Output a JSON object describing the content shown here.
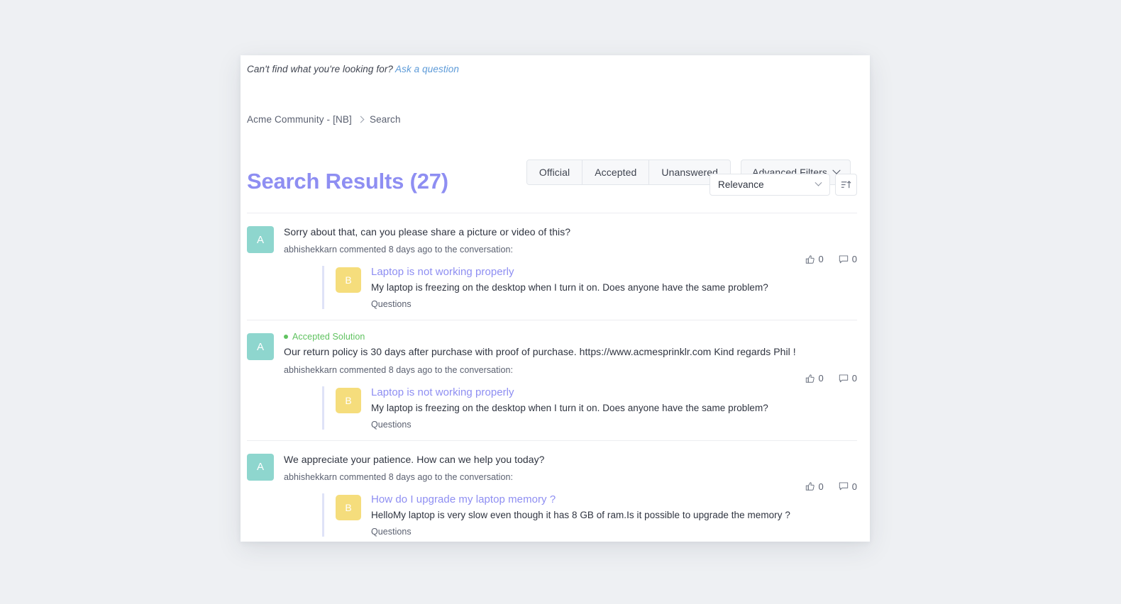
{
  "top_bar": {
    "prompt": "Can't find what you're looking for?",
    "ask_link": "Ask a question"
  },
  "breadcrumb": {
    "root": "Acme Community - [NB]",
    "current": "Search"
  },
  "filters": {
    "official": "Official",
    "accepted": "Accepted",
    "unanswered": "Unanswered",
    "advanced": "Advanced Filters"
  },
  "results_header": {
    "title": "Search Results (27)",
    "sort_value": "Relevance"
  },
  "colors": {
    "accent_purple": "#8e8ef2",
    "link_blue": "#5c9ad8",
    "accepted_green": "#5fc25f",
    "avatar_teal": "#8ed6ce",
    "avatar_yellow": "#f5dd7c"
  },
  "results": [
    {
      "avatar": "A",
      "accepted_label": "",
      "snippet": "Sorry about that, can you please share a picture or video of this?",
      "meta": "abhishekkarn commented 8 days ago to the conversation:",
      "likes": "0",
      "comments": "0",
      "quoted": {
        "avatar": "B",
        "title": "Laptop is not working properly",
        "description": "My laptop is freezing on the desktop when I turn it on. Does anyone have the same problem?",
        "category": "Questions"
      }
    },
    {
      "avatar": "A",
      "accepted_label": "Accepted Solution",
      "snippet": "Our return policy is 30 days after purchase with proof of purchase. https://www.acmesprinklr.com Kind regards Phil !",
      "meta": "abhishekkarn commented 8 days ago to the conversation:",
      "likes": "0",
      "comments": "0",
      "quoted": {
        "avatar": "B",
        "title": "Laptop is not working properly",
        "description": "My laptop is freezing on the desktop when I turn it on. Does anyone have the same problem?",
        "category": "Questions"
      }
    },
    {
      "avatar": "A",
      "accepted_label": "",
      "snippet": "We appreciate your patience. How can we help you today?",
      "meta": "abhishekkarn commented 8 days ago to the conversation:",
      "likes": "0",
      "comments": "0",
      "quoted": {
        "avatar": "B",
        "title": "How do I upgrade my laptop memory ?",
        "description": "HelloMy laptop is very slow even though it has 8 GB of ram.Is it possible to upgrade the memory ?",
        "category": "Questions"
      }
    }
  ]
}
